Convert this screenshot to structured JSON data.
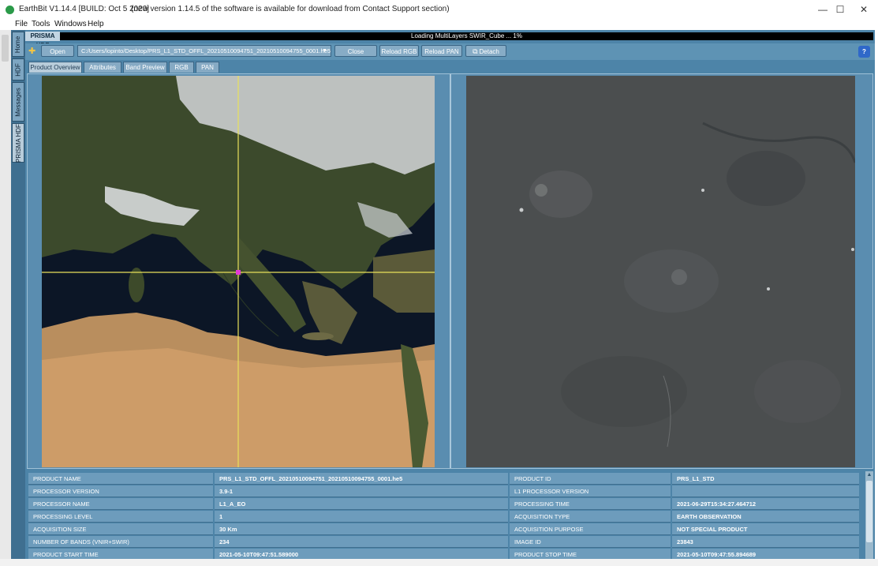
{
  "window": {
    "title": "EarthBit V1.14.4 [BUILD: Oct  5 2020]",
    "update_notice": "(new version 1.14.5 of the software is available for download from Contact Support section)",
    "controls": {
      "minimize": "—",
      "maximize": "☐",
      "close": "✕"
    }
  },
  "menu": [
    "File",
    "Tools",
    "Windows",
    "Help"
  ],
  "side_tabs": [
    "Home",
    "HDF",
    "Messages",
    "PRISMA HDF"
  ],
  "panel_tab": "PRISMA HDF",
  "progress": {
    "text": "Loading MultiLayers SWIR_Cube ... 1%",
    "value": 1
  },
  "toolbar": {
    "open": "Open",
    "path": "C:/Users/lopinto/Desktop/PRS_L1_STD_OFFL_20210510094751_20210510094755_0001.he5",
    "close": "Close",
    "reload_rgb": "Reload RGB",
    "reload_pan": "Reload PAN",
    "detach": "Detach",
    "help": "?"
  },
  "tabs": [
    "Product Overview",
    "Attributes",
    "Band Preview",
    "RGB",
    "PAN"
  ],
  "active_tab": "Product Overview",
  "info_rows": [
    {
      "k1": "PRODUCT NAME",
      "v1": "PRS_L1_STD_OFFL_20210510094751_20210510094755_0001.he5",
      "k2": "PRODUCT ID",
      "v2": "PRS_L1_STD"
    },
    {
      "k1": "PROCESSOR VERSION",
      "v1": "3.9-1",
      "k2": "L1 PROCESSOR VERSION",
      "v2": ""
    },
    {
      "k1": "PROCESSOR NAME",
      "v1": "L1_A_EO",
      "k2": "PROCESSING TIME",
      "v2": "2021-06-29T15:34:27.464712"
    },
    {
      "k1": "PROCESSING LEVEL",
      "v1": "1",
      "k2": "ACQUISITION TYPE",
      "v2": "EARTH OBSERVATION"
    },
    {
      "k1": "ACQUISITION SIZE",
      "v1": "30 Km",
      "k2": "ACQUISITION PURPOSE",
      "v2": "NOT SPECIAL PRODUCT"
    },
    {
      "k1": "NUMBER OF BANDS (VNIR+SWIR)",
      "v1": "234",
      "k2": "IMAGE ID",
      "v2": "23843"
    },
    {
      "k1": "PRODUCT START TIME",
      "v1": "2021-05-10T09:47:51.589000",
      "k2": "PRODUCT STOP TIME",
      "v2": "2021-05-10T09:47:55.894689"
    }
  ],
  "colors": {
    "app_background": "#4d84a8",
    "toolbar": "#5e93b4",
    "crosshair": "#e8e05a",
    "target_marker": "#e23ad6",
    "progress_bar": "#000000"
  }
}
